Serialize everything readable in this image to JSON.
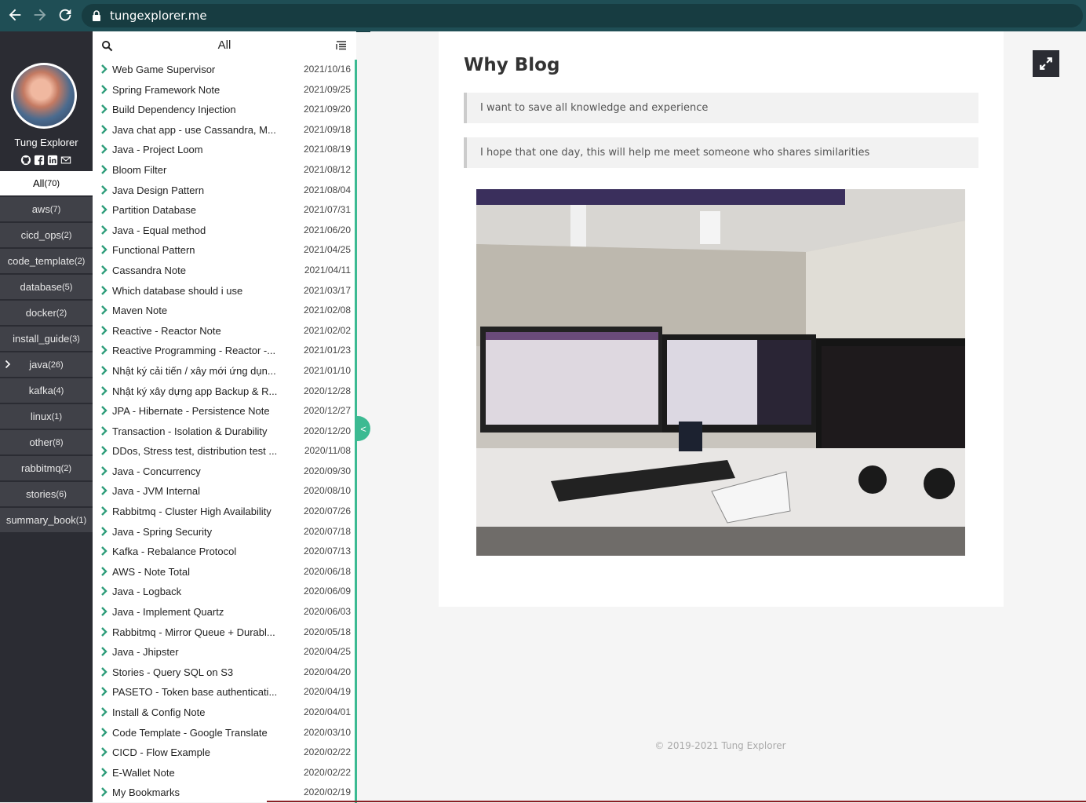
{
  "browser": {
    "url": "tungexplorer.me"
  },
  "sidebar": {
    "author": "Tung Explorer",
    "social_icons": [
      "github-icon",
      "facebook-icon",
      "linkedin-icon",
      "mail-icon"
    ],
    "categories": [
      {
        "name": "All",
        "count": "(70)",
        "active": true
      },
      {
        "name": "aws",
        "count": "(7)"
      },
      {
        "name": "cicd_ops",
        "count": "(2)"
      },
      {
        "name": "code_template",
        "count": "(2)"
      },
      {
        "name": "database",
        "count": "(5)"
      },
      {
        "name": "docker",
        "count": "(2)"
      },
      {
        "name": "install_guide",
        "count": "(3)"
      },
      {
        "name": "java",
        "count": "(26)",
        "expandable": true
      },
      {
        "name": "kafka",
        "count": "(4)"
      },
      {
        "name": "linux",
        "count": "(1)"
      },
      {
        "name": "other",
        "count": "(8)"
      },
      {
        "name": "rabbitmq",
        "count": "(2)"
      },
      {
        "name": "stories",
        "count": "(6)"
      },
      {
        "name": "summary_book",
        "count": "(1)"
      }
    ]
  },
  "list": {
    "title": "All",
    "posts": [
      {
        "title": "Web Game Supervisor",
        "date": "2021/10/16"
      },
      {
        "title": "Spring Framework Note",
        "date": "2021/09/25"
      },
      {
        "title": "Build Dependency Injection",
        "date": "2021/09/20"
      },
      {
        "title": "Java chat app - use Cassandra, M...",
        "date": "2021/09/18"
      },
      {
        "title": "Java - Project Loom",
        "date": "2021/08/19"
      },
      {
        "title": "Bloom Filter",
        "date": "2021/08/12"
      },
      {
        "title": "Java Design Pattern",
        "date": "2021/08/04"
      },
      {
        "title": "Partition Database",
        "date": "2021/07/31"
      },
      {
        "title": "Java - Equal method",
        "date": "2021/06/20"
      },
      {
        "title": "Functional Pattern",
        "date": "2021/04/25"
      },
      {
        "title": "Cassandra Note",
        "date": "2021/04/11"
      },
      {
        "title": "Which database should i use",
        "date": "2021/03/17"
      },
      {
        "title": "Maven Note",
        "date": "2021/02/08"
      },
      {
        "title": "Reactive - Reactor Note",
        "date": "2021/02/02"
      },
      {
        "title": "Reactive Programming - Reactor -...",
        "date": "2021/01/23"
      },
      {
        "title": "Nhật ký cải tiến / xây mới ứng dụn...",
        "date": "2021/01/10"
      },
      {
        "title": "Nhật ký xây dựng app Backup & R...",
        "date": "2020/12/28"
      },
      {
        "title": "JPA - Hibernate - Persistence Note",
        "date": "2020/12/27"
      },
      {
        "title": "Transaction - Isolation & Durability",
        "date": "2020/12/20"
      },
      {
        "title": "DDos, Stress test, distribution test ...",
        "date": "2020/11/08"
      },
      {
        "title": "Java - Concurrency",
        "date": "2020/09/30"
      },
      {
        "title": "Java - JVM Internal",
        "date": "2020/08/10"
      },
      {
        "title": "Rabbitmq - Cluster High Availability",
        "date": "2020/07/26"
      },
      {
        "title": "Java - Spring Security",
        "date": "2020/07/18"
      },
      {
        "title": "Kafka - Rebalance Protocol",
        "date": "2020/07/13"
      },
      {
        "title": "AWS - Note Total",
        "date": "2020/06/18"
      },
      {
        "title": "Java - Logback",
        "date": "2020/06/09"
      },
      {
        "title": "Java - Implement Quartz",
        "date": "2020/06/03"
      },
      {
        "title": "Rabbitmq - Mirror Queue + Durabl...",
        "date": "2020/05/18"
      },
      {
        "title": "Java - Jhipster",
        "date": "2020/04/25"
      },
      {
        "title": "Stories - Query SQL on S3",
        "date": "2020/04/20"
      },
      {
        "title": "PASETO - Token base authenticati...",
        "date": "2020/04/19"
      },
      {
        "title": "Install & Config Note",
        "date": "2020/04/01"
      },
      {
        "title": "Code Template - Google Translate",
        "date": "2020/03/10"
      },
      {
        "title": "CICD - Flow Example",
        "date": "2020/02/22"
      },
      {
        "title": "E-Wallet Note",
        "date": "2020/02/22"
      },
      {
        "title": "My Bookmarks",
        "date": "2020/02/19"
      }
    ],
    "collapse_symbol": "<"
  },
  "main": {
    "title": "Why Blog",
    "quotes": [
      "I want to save all knowledge and experience",
      "I hope that one day, this will help me meet someone who shares similarities"
    ],
    "footer": "© 2019-2021 Tung Explorer"
  },
  "colors": {
    "accent": "#3cba92",
    "sidebar": "#2b2c33",
    "chrome": "#1f4e55"
  }
}
